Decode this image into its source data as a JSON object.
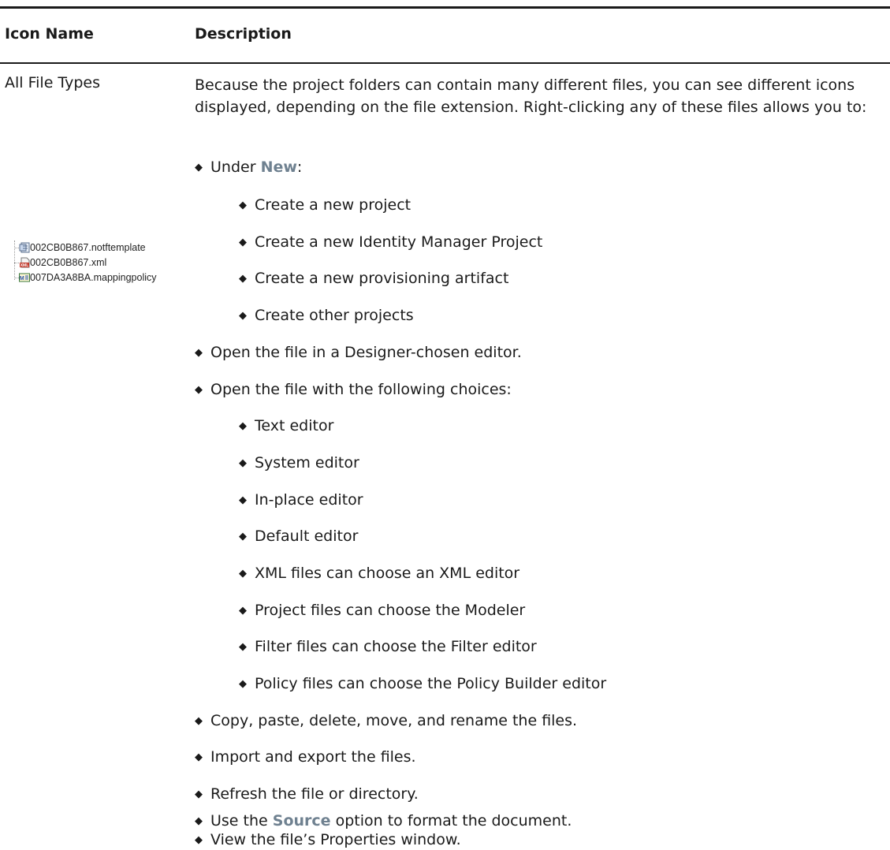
{
  "table": {
    "header_icon_name": "Icon Name",
    "header_description": "Description",
    "icon_name": "All File Types",
    "intro": "Because the project folders can contain many different files, you can see different icons displayed, depending on the file extension. Right-clicking any of these files allows you to:"
  },
  "icon_tree": {
    "files": [
      {
        "name": "002CB0B867.notftemplate",
        "icon": "template-file-icon"
      },
      {
        "name": "002CB0B867.xml",
        "icon": "xml-file-icon"
      },
      {
        "name": "007DA3A8BA.mappingpolicy",
        "icon": "mapping-policy-icon"
      }
    ]
  },
  "list": {
    "under_prefix": "Under ",
    "under_new": "New",
    "under_suffix": ":",
    "new_items": [
      "Create a new project",
      "Create a new Identity Manager Project",
      "Create a new provisioning artifact",
      "Create other projects"
    ],
    "open_designer": "Open the file in a Designer-chosen editor.",
    "open_with": "Open the file with the following choices:",
    "open_with_items": [
      "Text editor",
      "System editor",
      "In-place editor",
      "Default editor",
      "XML files can choose an XML editor",
      "Project files can choose the Modeler",
      "Filter files can choose the Filter editor",
      "Policy files can choose the Policy Builder editor"
    ],
    "copy": "Copy, paste, delete, move, and rename the files.",
    "import_export": "Import and export the files.",
    "refresh": "Refresh the file or directory.",
    "source_prefix": "Use the ",
    "source_word": "Source",
    "source_suffix": " option to format the document.",
    "properties": "View the file’s Properties window."
  },
  "bullet_glyph": "◆",
  "colors": {
    "accent": "#6f8190",
    "text": "#1a1a1a",
    "rule": "#1a1a1a"
  }
}
